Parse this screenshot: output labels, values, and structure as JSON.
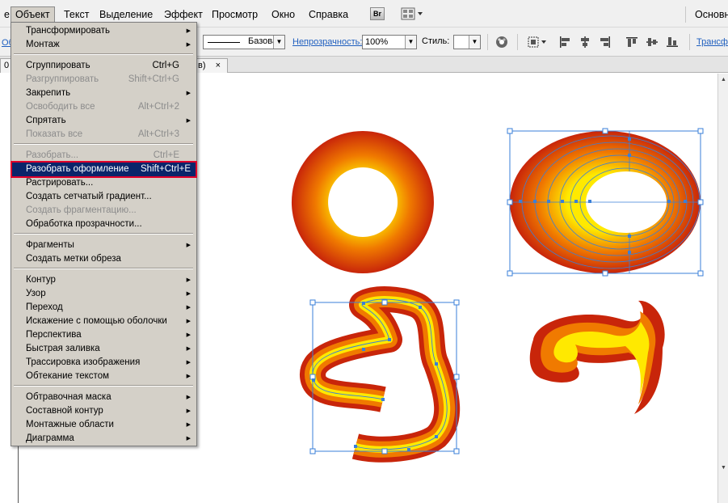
{
  "menubar": {
    "items": [
      "е",
      "Объект",
      "Текст",
      "Выделение",
      "Эффект",
      "Просмотр",
      "Окно",
      "Справка"
    ],
    "bridge": "Br",
    "workspace": "Основн"
  },
  "control": {
    "left_label": "Об",
    "stroke_label": "Базовая",
    "opacity_label": "Непрозрачность:",
    "opacity_value": "100%",
    "style_label": "Стиль:",
    "transform_label": "Трансф"
  },
  "tab": {
    "label": "0 6",
    "suffix": "в)",
    "close": "×"
  },
  "menu": {
    "items": [
      {
        "label": "Трансформировать",
        "sub": true
      },
      {
        "label": "Монтаж",
        "sub": true
      },
      {
        "label": "Сгруппировать",
        "shortcut": "Ctrl+G"
      },
      {
        "label": "Разгруппировать",
        "shortcut": "Shift+Ctrl+G",
        "disabled": true
      },
      {
        "label": "Закрепить",
        "sub": true
      },
      {
        "label": "Освободить все",
        "shortcut": "Alt+Ctrl+2",
        "disabled": true
      },
      {
        "label": "Спрятать",
        "sub": true
      },
      {
        "label": "Показать все",
        "shortcut": "Alt+Ctrl+3",
        "disabled": true
      },
      {
        "label": "Разобрать...",
        "shortcut": "Ctrl+E",
        "disabled": true
      },
      {
        "label": "Разобрать оформление",
        "shortcut": "Shift+Ctrl+E",
        "highlighted": true
      },
      {
        "label": "Растрировать..."
      },
      {
        "label": "Создать сетчатый градиент..."
      },
      {
        "label": "Создать фрагментацию...",
        "disabled": true
      },
      {
        "label": "Обработка прозрачности..."
      },
      {
        "label": "Фрагменты",
        "sub": true
      },
      {
        "label": "Создать метки обреза"
      },
      {
        "label": "Контур",
        "sub": true
      },
      {
        "label": "Узор",
        "sub": true
      },
      {
        "label": "Переход",
        "sub": true
      },
      {
        "label": "Искажение с помощью оболочки",
        "sub": true
      },
      {
        "label": "Перспектива",
        "sub": true
      },
      {
        "label": "Быстрая заливка",
        "sub": true
      },
      {
        "label": "Трассировка изображения",
        "sub": true
      },
      {
        "label": "Обтекание текстом",
        "sub": true
      },
      {
        "label": "Обтравочная маска",
        "sub": true
      },
      {
        "label": "Составной контур",
        "sub": true
      },
      {
        "label": "Монтажные области",
        "sub": true
      },
      {
        "label": "Диаграмма",
        "sub": true
      }
    ]
  },
  "colors": {
    "gradient_outer": "#c8250a",
    "gradient_mid": "#f07a00",
    "gradient_inner": "#ffe900",
    "selection": "#3a7fd8",
    "menu_highlight": "#0a246a"
  }
}
